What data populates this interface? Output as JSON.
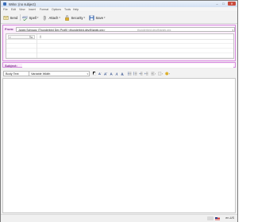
{
  "window": {
    "title": "Write: (no subject)",
    "controls": {
      "minimize": "–",
      "maximize": "□",
      "close": "✕"
    }
  },
  "menubar": {
    "items": [
      "File",
      "Edit",
      "View",
      "Insert",
      "Format",
      "Options",
      "Tools",
      "Help"
    ]
  },
  "toolbar": {
    "send": {
      "label": "Send",
      "icon": "send-icon"
    },
    "spell": {
      "label": "Spell",
      "icon": "spellcheck-icon"
    },
    "attach": {
      "label": "Attach",
      "icon": "paperclip-icon"
    },
    "security": {
      "label": "Security",
      "icon": "lock-icon"
    },
    "save": {
      "label": "Save",
      "icon": "floppy-icon"
    },
    "dropdown_glyph": "▾"
  },
  "compose": {
    "from_label": "From:",
    "from_value": "Janek Schwarz (Thunderbird Dev Profil) <thunderbird.dev@janek.org>",
    "from_account": "thunderbird.dev@janek.org",
    "recipient_type": "To:",
    "recipient_value": "",
    "subject_label": "Subject:",
    "subject_value": ""
  },
  "format": {
    "paragraph_style": "Body Text",
    "font": "Variable Width"
  },
  "status": {
    "language": "en-US"
  },
  "colors": {
    "header_bg": "#fbeefb",
    "header_border": "#d88be0",
    "accent": "#3b6db7"
  }
}
